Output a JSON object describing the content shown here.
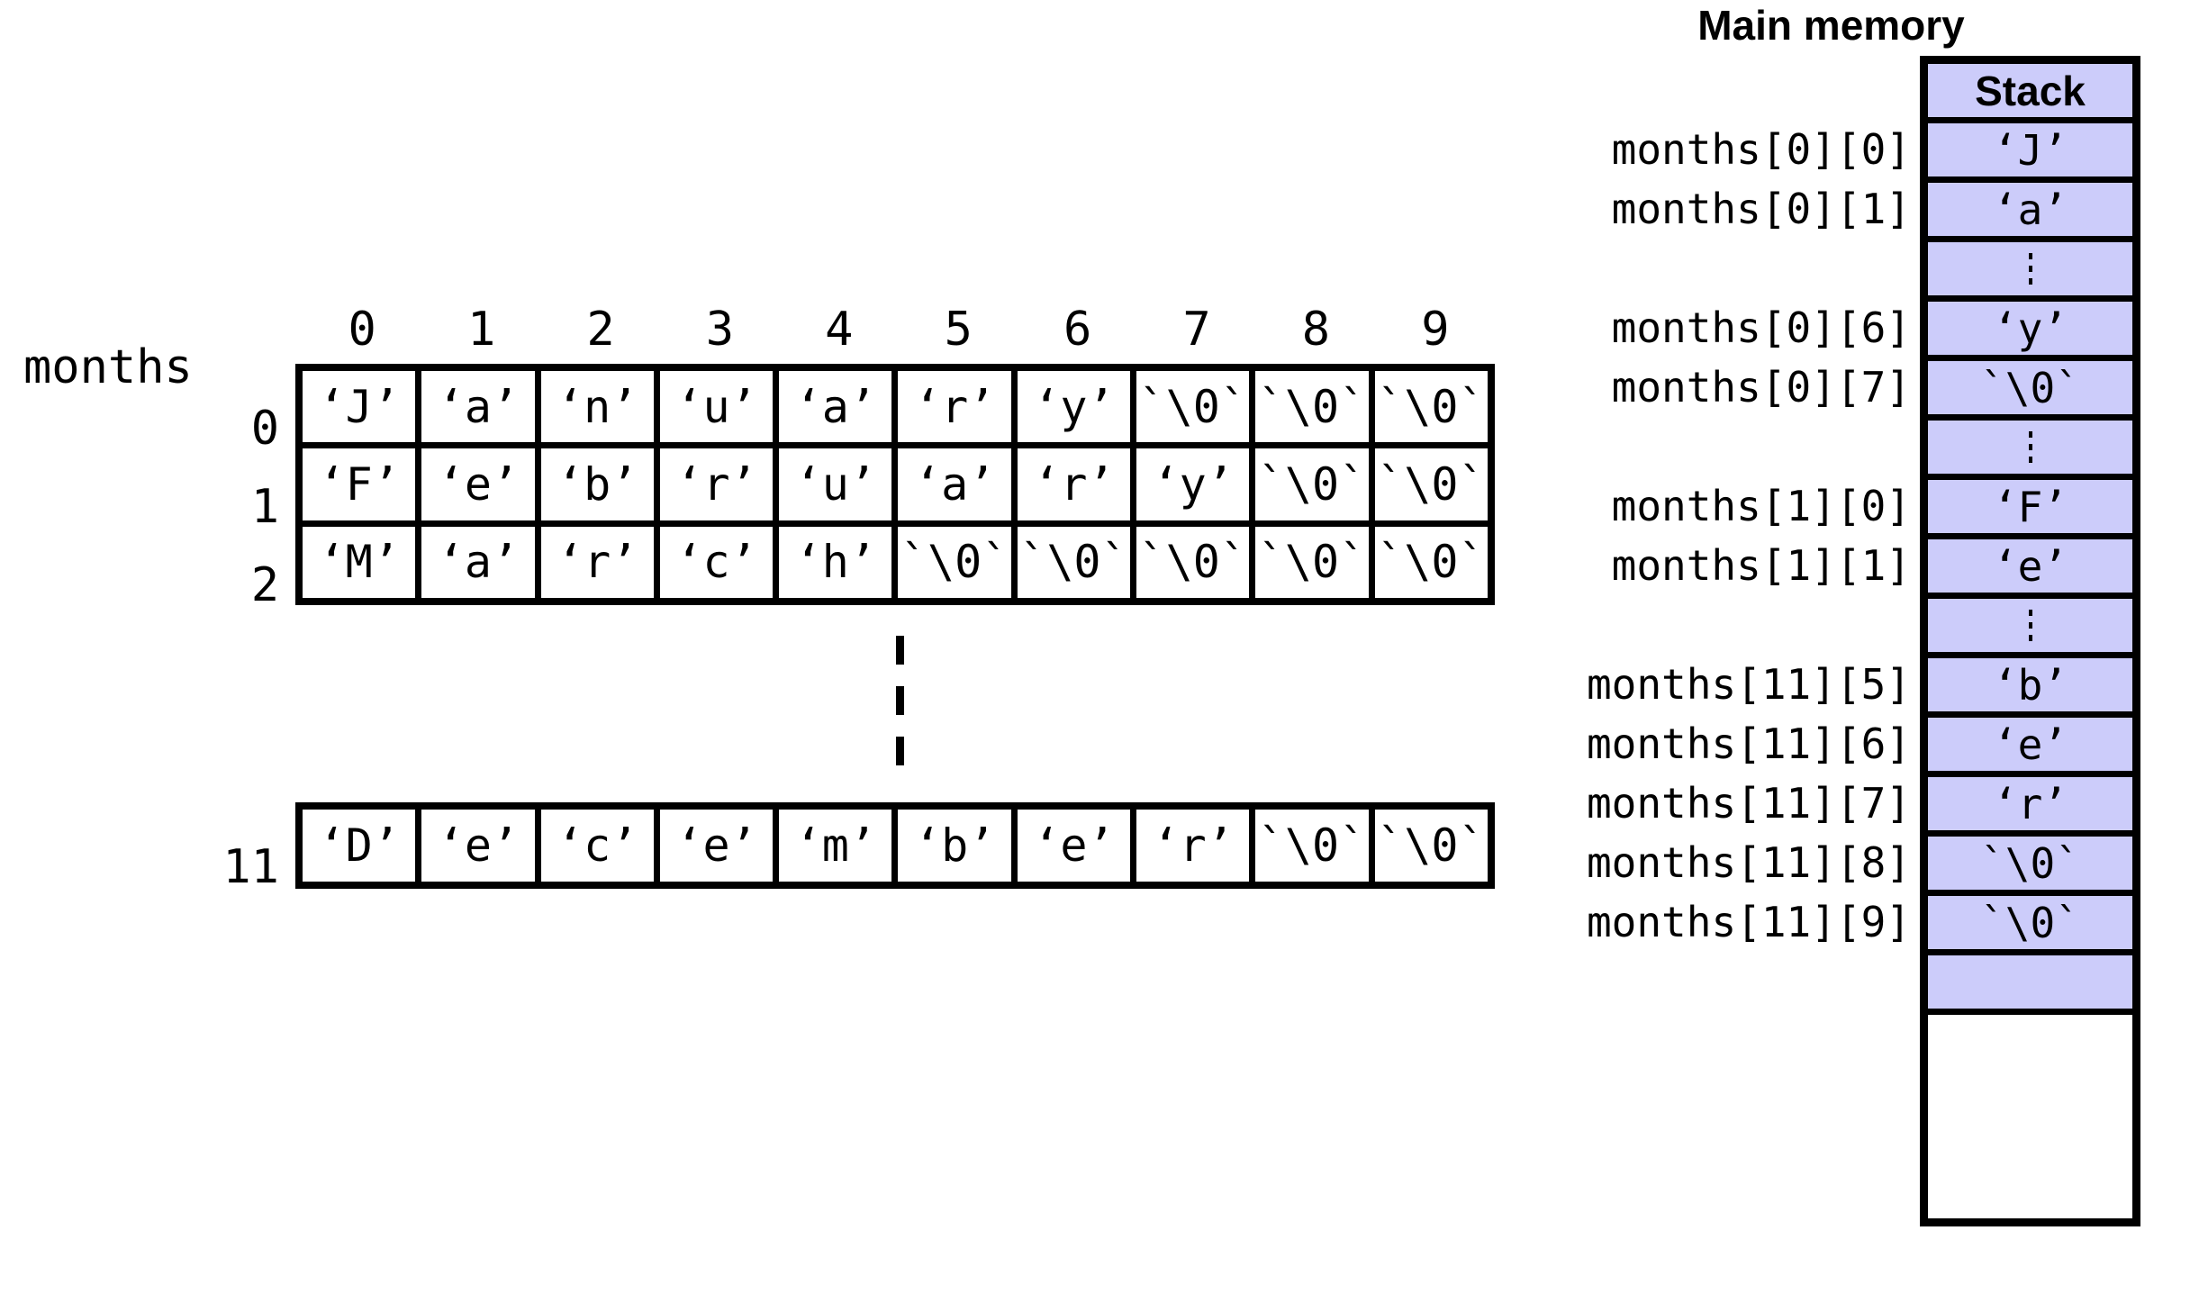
{
  "array": {
    "variable_name": "months",
    "column_headers": [
      "0",
      "1",
      "2",
      "3",
      "4",
      "5",
      "6",
      "7",
      "8",
      "9"
    ],
    "rows": [
      {
        "index": "0",
        "cells": [
          "‘J’",
          "‘a’",
          "‘n’",
          "‘u’",
          "‘a’",
          "‘r’",
          "‘y’",
          "`\\0`",
          "`\\0`",
          "`\\0`"
        ]
      },
      {
        "index": "1",
        "cells": [
          "‘F’",
          "‘e’",
          "‘b’",
          "‘r’",
          "‘u’",
          "‘a’",
          "‘r’",
          "‘y’",
          "`\\0`",
          "`\\0`"
        ]
      },
      {
        "index": "2",
        "cells": [
          "‘M’",
          "‘a’",
          "‘r’",
          "‘c’",
          "‘h’",
          "`\\0`",
          "`\\0`",
          "`\\0`",
          "`\\0`",
          "`\\0`"
        ]
      }
    ],
    "last_row": {
      "index": "11",
      "cells": [
        "‘D’",
        "‘e’",
        "‘c’",
        "‘e’",
        "‘m’",
        "‘b’",
        "‘e’",
        "‘r’",
        "`\\0`",
        "`\\0`"
      ]
    }
  },
  "memory": {
    "title": "Main memory",
    "segment_header": "Stack",
    "fill_color": "#ccccfa",
    "cells": [
      {
        "label": "",
        "value": "Stack",
        "kind": "header"
      },
      {
        "label": "months[0][0]",
        "value": "‘J’",
        "kind": "value"
      },
      {
        "label": "months[0][1]",
        "value": "‘a’",
        "kind": "value"
      },
      {
        "label": "",
        "value": "",
        "kind": "vdots"
      },
      {
        "label": "months[0][6]",
        "value": "‘y’",
        "kind": "value"
      },
      {
        "label": "months[0][7]",
        "value": "`\\0`",
        "kind": "value"
      },
      {
        "label": "",
        "value": "",
        "kind": "vdots"
      },
      {
        "label": "months[1][0]",
        "value": "‘F’",
        "kind": "value"
      },
      {
        "label": "months[1][1]",
        "value": "‘e’",
        "kind": "value"
      },
      {
        "label": "",
        "value": "",
        "kind": "vdots"
      },
      {
        "label": "months[11][5]",
        "value": "‘b’",
        "kind": "value"
      },
      {
        "label": "months[11][6]",
        "value": "‘e’",
        "kind": "value"
      },
      {
        "label": "months[11][7]",
        "value": "‘r’",
        "kind": "value"
      },
      {
        "label": "months[11][8]",
        "value": "`\\0`",
        "kind": "value"
      },
      {
        "label": "months[11][9]",
        "value": "`\\0`",
        "kind": "value"
      },
      {
        "label": "",
        "value": "",
        "kind": "blank"
      },
      {
        "label": "",
        "value": "",
        "kind": "free"
      }
    ]
  }
}
